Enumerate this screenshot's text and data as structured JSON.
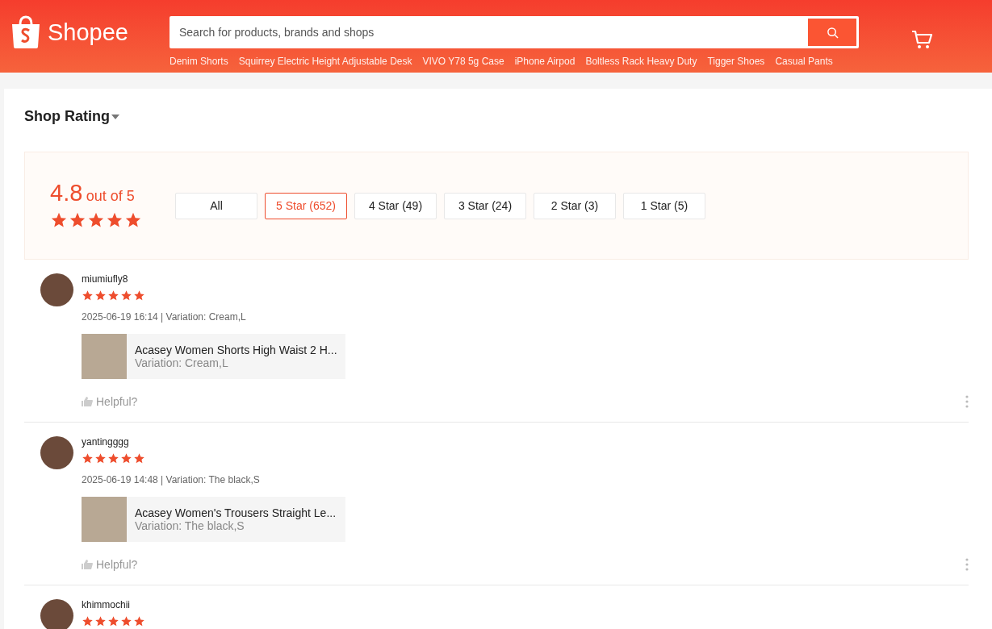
{
  "header": {
    "logo": "Shopee",
    "search": {
      "placeholder": "Search for products, brands and shops"
    },
    "suggestions": [
      "Denim Shorts",
      "Squirrey Electric Height Adjustable Desk",
      "VIVO Y78 5g Case",
      "iPhone Airpod",
      "Boltless Rack Heavy Duty",
      "Tigger Shoes",
      "Casual Pants"
    ]
  },
  "section_title": "Shop Rating",
  "summary": {
    "score": "4.8",
    "out_of": "out of 5",
    "stars": 5
  },
  "filters": [
    {
      "label": "All",
      "selected": false
    },
    {
      "label": "5 Star (652)",
      "selected": true
    },
    {
      "label": "4 Star (49)",
      "selected": false
    },
    {
      "label": "3 Star (24)",
      "selected": false
    },
    {
      "label": "2 Star (3)",
      "selected": false
    },
    {
      "label": "1 Star (5)",
      "selected": false
    }
  ],
  "reviews": [
    {
      "user": "miumiufly8",
      "stars": 5,
      "meta": "2025-06-19 16:14 | Variation: Cream,L",
      "product": "Acasey Women Shorts High Waist 2 H...",
      "variation": "Variation: Cream,L",
      "helpful": "Helpful?"
    },
    {
      "user": "yantingggg",
      "stars": 5,
      "meta": "2025-06-19 14:48 | Variation: The black,S",
      "product": "Acasey Women's Trousers Straight Le...",
      "variation": "Variation: The black,S",
      "helpful": "Helpful?"
    },
    {
      "user": "khimmochii",
      "stars": 5
    }
  ]
}
